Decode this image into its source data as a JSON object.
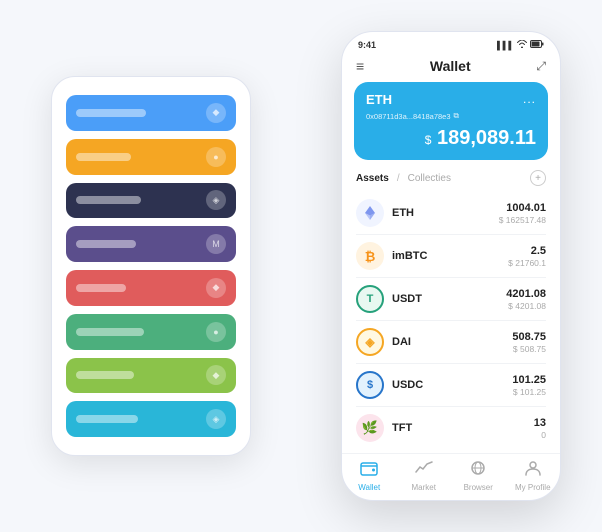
{
  "backPhone": {
    "cards": [
      {
        "color": "card-blue",
        "lineWidth": 70,
        "icon": "◆"
      },
      {
        "color": "card-orange",
        "lineWidth": 55,
        "icon": "●"
      },
      {
        "color": "card-dark",
        "lineWidth": 65,
        "icon": "◈"
      },
      {
        "color": "card-purple",
        "lineWidth": 60,
        "icon": "M"
      },
      {
        "color": "card-red",
        "lineWidth": 50,
        "icon": "◆"
      },
      {
        "color": "card-green",
        "lineWidth": 68,
        "icon": "●"
      },
      {
        "color": "card-lime",
        "lineWidth": 58,
        "icon": "◆"
      },
      {
        "color": "card-teal",
        "lineWidth": 62,
        "icon": "◈"
      }
    ]
  },
  "frontPhone": {
    "statusBar": {
      "time": "9:41",
      "icons": [
        "▌▌▌",
        "WiFi",
        "🔋"
      ]
    },
    "header": {
      "menuIcon": "≡",
      "title": "Wallet",
      "expandIcon": "⤢"
    },
    "ethCard": {
      "name": "ETH",
      "moreIcon": "...",
      "address": "0x08711d3a...8418a78e3",
      "copyIcon": "⧉",
      "amountPrefix": "$",
      "amount": "189,089.11"
    },
    "assets": {
      "activeTab": "Assets",
      "divider": "/",
      "inactiveTab": "Collecties",
      "addIcon": "+"
    },
    "assetList": [
      {
        "icon": "♦",
        "iconBg": "eth-icon",
        "iconColor": "#627eea",
        "name": "ETH",
        "amount": "1004.01",
        "usd": "$ 162517.48"
      },
      {
        "icon": "₿",
        "iconBg": "imbtc-icon",
        "iconColor": "#f7931a",
        "name": "imBTC",
        "amount": "2.5",
        "usd": "$ 21760.1"
      },
      {
        "icon": "T",
        "iconBg": "usdt-icon",
        "iconColor": "#26a17b",
        "name": "USDT",
        "amount": "4201.08",
        "usd": "$ 4201.08"
      },
      {
        "icon": "◈",
        "iconBg": "dai-icon",
        "iconColor": "#f5a623",
        "name": "DAI",
        "amount": "508.75",
        "usd": "$ 508.75"
      },
      {
        "icon": "$",
        "iconBg": "usdc-icon",
        "iconColor": "#2775ca",
        "name": "USDC",
        "amount": "101.25",
        "usd": "$ 101.25"
      },
      {
        "icon": "🌿",
        "iconBg": "tft-icon",
        "iconColor": "#e91e63",
        "name": "TFT",
        "amount": "13",
        "usd": "0"
      }
    ],
    "bottomNav": [
      {
        "icon": "◎",
        "label": "Wallet",
        "active": true
      },
      {
        "icon": "◻",
        "label": "Market",
        "active": false
      },
      {
        "icon": "⊕",
        "label": "Browser",
        "active": false
      },
      {
        "icon": "◉",
        "label": "My Profile",
        "active": false
      }
    ]
  }
}
